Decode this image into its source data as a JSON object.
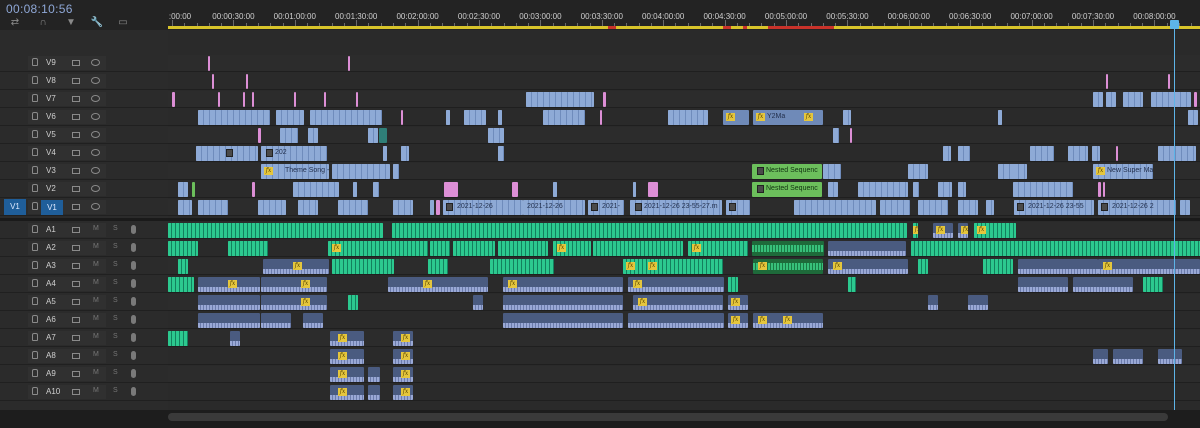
{
  "timecode": "00:08:10:56",
  "toolbar": [
    {
      "name": "snap-icon",
      "glyph": "⇄"
    },
    {
      "name": "linked-selection-icon",
      "glyph": "∩"
    },
    {
      "name": "add-marker-icon",
      "glyph": "▼"
    },
    {
      "name": "wrench-icon",
      "glyph": "🔧"
    },
    {
      "name": "captions-icon",
      "glyph": "▭"
    }
  ],
  "ruler": {
    "labels": [
      ":00:00",
      "00:00:30:00",
      "00:01:00:00",
      "00:01:30:00",
      "00:02:00:00",
      "00:02:30:00",
      "00:03:00:00",
      "00:03:30:00",
      "00:04:00:00",
      "00:04:30:00",
      "00:05:00:00",
      "00:05:30:00",
      "00:06:00:00",
      "00:06:30:00",
      "00:07:00:00",
      "00:07:30:00",
      "00:08:00:00"
    ]
  },
  "tracks": {
    "video": [
      "V9",
      "V8",
      "V7",
      "V6",
      "V5",
      "V4",
      "V3",
      "V2",
      "V1"
    ],
    "audio": [
      "A1",
      "A2",
      "A3",
      "A4",
      "A5",
      "A6",
      "A7",
      "A8",
      "A9",
      "A10"
    ],
    "source_patch": "V1",
    "mute_label": "M",
    "solo_label": "S"
  },
  "clip_labels": {
    "v6_y2ma": "Y2Ma",
    "v4_202": "202",
    "v3_theme": "Theme Song -",
    "v3_nested": "Nested Sequenc",
    "v3_mario": "New Super Mario B",
    "v2_nested": "Nested Sequenc",
    "v1_a": "2021-12-26",
    "v1_b": "2021-12-26",
    "v1_c": "2021-",
    "v1_d": "2021-12-26 23-55-27.m",
    "v1_e": "2021-12-26 23-55",
    "v1_f": "2021-12-26 2"
  },
  "fx_label": "fx",
  "colors": {
    "video_clip": "#8eaad6",
    "adjustment_clip": "#dd8fd6",
    "nested_clip": "#6cbf5c",
    "audio_clip": "#2cc98f",
    "playhead": "#5db4e8",
    "workarea": "#d8c42a"
  }
}
